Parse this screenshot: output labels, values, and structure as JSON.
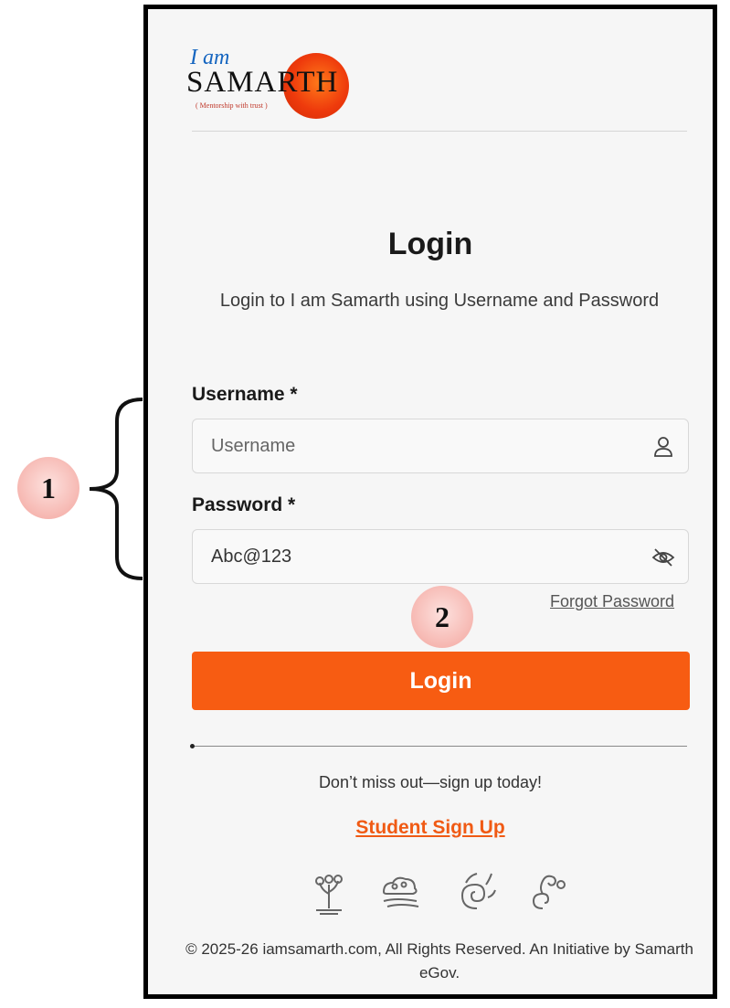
{
  "logo": {
    "iam": "I am",
    "word": "SAMARTH",
    "tagline": "( Mentorship with trust )"
  },
  "title": "Login",
  "subtitle": "Login to I am Samarth using Username and Password",
  "username": {
    "label": "Username *",
    "placeholder": "Username",
    "icon": "user-icon"
  },
  "password": {
    "label": "Password *",
    "value": "Abc@123",
    "icon": "eye-off-icon"
  },
  "forgot_password": "Forgot Password",
  "login_button": "Login",
  "tagline": "Don’t miss out—sign up today!",
  "signup_link": "Student Sign Up",
  "footer": "© 2025-26 iamsamarth.com, All Rights Reserved. An Initiative by Samarth eGov.",
  "callouts": [
    "1",
    "2"
  ],
  "colors": {
    "accent": "#f75c12",
    "link": "#f05a14",
    "logo_blue": "#1565c0"
  }
}
